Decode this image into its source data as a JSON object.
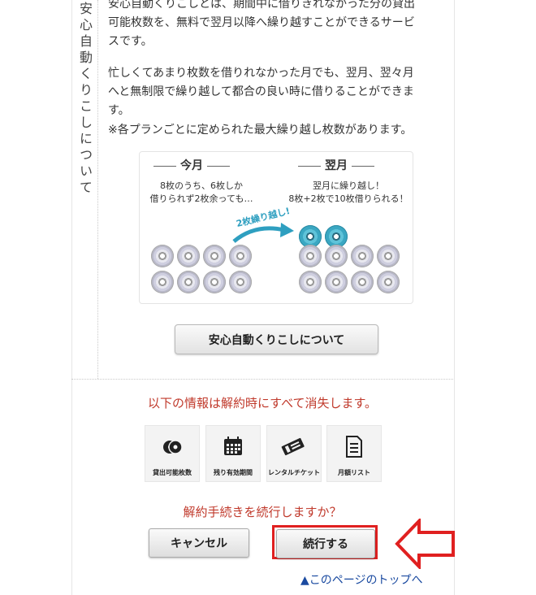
{
  "side_title": "安心自動くりこしについて",
  "description": {
    "line1": "安心自動くりこしとは、期間中に借りきれなかった分の貸出",
    "line2": "可能枚数を、無料で翌月以降へ繰り越すことができるサービ",
    "line3": "スです。",
    "line4": "忙しくてあまり枚数を借りれなかった月でも、翌月、翌々月",
    "line5": "へと無制限で繰り越して都合の良い時に借りることができま",
    "line6": "す。",
    "note": "※各プランごとに定められた最大繰り越し枚数があります。"
  },
  "illustration": {
    "this_month_title": "今月",
    "this_month_line1": "8枚のうち、6枚しか",
    "this_month_line2": "借りられず2枚余っても…",
    "next_month_title": "翌月",
    "next_month_line1": "翌月に繰り越し！",
    "next_month_line2": "8枚+2枚で10枚借りられる！",
    "arrow_label": "2枚繰り越し!"
  },
  "about_button_label": "安心自動くりこしについて",
  "warning_text": "以下の情報は解約時にすべて消失します。",
  "info_tiles": [
    {
      "label": "貸出可能枚数",
      "icon": "disc-icon"
    },
    {
      "label": "残り有効期間",
      "icon": "calendar-icon"
    },
    {
      "label": "レンタルチケット",
      "icon": "ticket-icon"
    },
    {
      "label": "月額リスト",
      "icon": "list-icon"
    }
  ],
  "confirm_text": "解約手続きを続行しますか？",
  "cancel_label": "キャンセル",
  "continue_label": "続行する",
  "page_top_link": "▲このページのトップへ",
  "colors": {
    "warning": "#c0392b",
    "highlight": "#e02020",
    "link": "#1a4aa0",
    "disc_blue": "#3aa7c2"
  }
}
